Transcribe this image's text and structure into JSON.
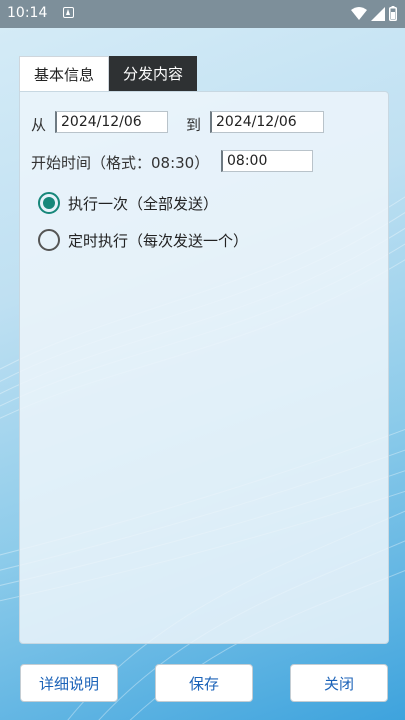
{
  "status_bar": {
    "time": "10:14",
    "icons": [
      "notification-icon",
      "wifi-icon",
      "signal-icon",
      "battery-icon"
    ]
  },
  "tabs": [
    {
      "label": "基本信息",
      "active": true
    },
    {
      "label": "分发内容",
      "active": false
    }
  ],
  "form": {
    "from_label": "从",
    "from_value": "2024/12/06",
    "to_label": "到",
    "to_value": "2024/12/06",
    "start_time_label": "开始时间（格式：08:30）",
    "start_time_value": "08:00",
    "radios": [
      {
        "label": "执行一次（全部发送）",
        "checked": true
      },
      {
        "label": "定时执行（每次发送一个）",
        "checked": false
      }
    ]
  },
  "buttons": {
    "details": "详细说明",
    "save": "保存",
    "close": "关闭"
  },
  "colors": {
    "accent": "#17877a",
    "button_text": "#1c63b8",
    "tab_inactive_bg": "#2e3133",
    "status_bar_bg": "#7d8f9a"
  }
}
